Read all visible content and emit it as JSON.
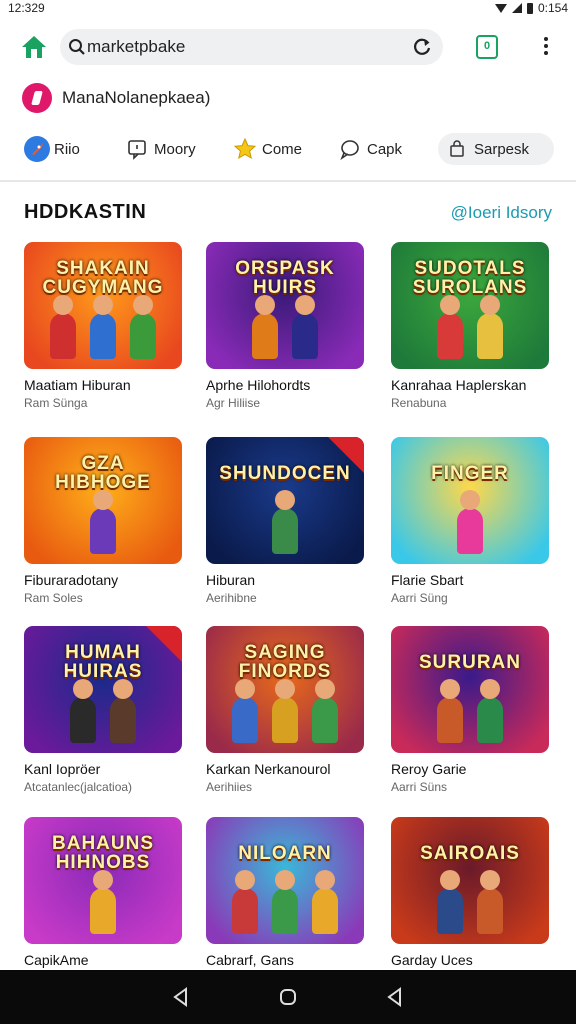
{
  "status_bar": {
    "time": "12:329",
    "battery_text": "0:154"
  },
  "browser": {
    "url": "marketpbake",
    "icons": {
      "home": "home-icon",
      "search": "search-icon",
      "reload": "reload-icon",
      "tabs": "tabs-icon",
      "menu": "more-vert-icon"
    },
    "home_color": "#1aa260"
  },
  "site": {
    "name": "ManaNolanepkaea)",
    "logo_color": "#e0186a"
  },
  "chips": [
    {
      "label": "Riio",
      "icon": "rocket-icon"
    },
    {
      "label": "Moory",
      "icon": "chat-icon"
    },
    {
      "label": "Come",
      "icon": "star-icon"
    },
    {
      "label": "Capk",
      "icon": "speech-bubble-icon"
    },
    {
      "label": "Sarpesk",
      "icon": "bag-icon"
    }
  ],
  "section": {
    "title": "HDDKASTIN",
    "link": "@Ioeri Idsory",
    "link_color": "#1b9bb0"
  },
  "games": [
    {
      "title": "Maatiam Hiburan",
      "subtitle": "Ram Sünga",
      "banner": "SHAKAIN CUGYMANG",
      "bg": [
        "#ff9a1a",
        "#e8471f"
      ],
      "figure_colors": [
        "#d02f2f",
        "#2f6fd0",
        "#3b9b3b"
      ],
      "badge": ""
    },
    {
      "title": "Aprhe Hilohordts",
      "subtitle": "Agr Hiliise",
      "banner": "ORSPASK HUIRS",
      "bg": [
        "#3a1a78",
        "#8a2bb8"
      ],
      "figure_colors": [
        "#e07b1a",
        "#2a2a8a"
      ],
      "badge": ""
    },
    {
      "title": "Kanrahaa Haplerskan",
      "subtitle": "Renabuna",
      "banner": "SUDOTALS SUROLANS",
      "bg": [
        "#3ca83c",
        "#1e7a3a"
      ],
      "figure_colors": [
        "#d83a3a",
        "#e8c040"
      ],
      "badge": ""
    },
    {
      "title": "Fiburaradotany",
      "subtitle": "Ram Soles",
      "banner": "GZA HIBHOGE",
      "bg": [
        "#ffb01a",
        "#e85a10"
      ],
      "figure_colors": [
        "#6a3ab8"
      ],
      "badge": ""
    },
    {
      "title": "Hiburan",
      "subtitle": "Aerihibne",
      "banner": "SHUNDOCEN",
      "bg": [
        "#1a3a8a",
        "#0a1a4a"
      ],
      "figure_colors": [
        "#3a8a4a"
      ],
      "badge": "ribbon"
    },
    {
      "title": "Flarie Sbart",
      "subtitle": "Aarri Süng",
      "banner": "FINGER",
      "bg": [
        "#ffd84a",
        "#3ac8e8"
      ],
      "figure_colors": [
        "#e83a9a"
      ],
      "badge": ""
    },
    {
      "title": "Kanl Iopröer",
      "subtitle": "Atcatanlec(jalcatioa)",
      "banner": "HUMAH HUIRAS",
      "bg": [
        "#1a2a8a",
        "#6a1a9a"
      ],
      "figure_colors": [
        "#2a2a2a",
        "#5a3a2a"
      ],
      "badge": "ribbon"
    },
    {
      "title": "Karkan Nerkanourol",
      "subtitle": "Aerihiies",
      "banner": "SAGING FINORDS",
      "bg": [
        "#e86a1a",
        "#9a2a4a"
      ],
      "figure_colors": [
        "#3a6ac8",
        "#d8a020",
        "#3a9a4a"
      ],
      "badge": ""
    },
    {
      "title": "Reroy Garie",
      "subtitle": "Aarri Süns",
      "banner": "SURURAN",
      "bg": [
        "#3a1a8a",
        "#c82a5a"
      ],
      "figure_colors": [
        "#c85a2a",
        "#2a8a4a"
      ],
      "badge": ""
    },
    {
      "title": "CapikAme",
      "subtitle": "",
      "banner": "BAHAUNS HIHNOBS",
      "bg": [
        "#8a2ab8",
        "#c83ac8"
      ],
      "figure_colors": [
        "#e8a82a"
      ],
      "badge": ""
    },
    {
      "title": "Cabrarf, Gans",
      "subtitle": "",
      "banner": "NILOARN",
      "bg": [
        "#3ab8d8",
        "#8a3ab8"
      ],
      "figure_colors": [
        "#c83a3a",
        "#3a9a4a",
        "#e8a82a"
      ],
      "badge": ""
    },
    {
      "title": "Garday Uces",
      "subtitle": "",
      "banner": "SAIROAIS",
      "bg": [
        "#6a1a2a",
        "#c83a1a"
      ],
      "figure_colors": [
        "#2a4a8a",
        "#c85a2a"
      ],
      "badge": ""
    }
  ],
  "nav_bar": {
    "icons": [
      "back-icon",
      "home-circle-icon",
      "recents-icon"
    ]
  }
}
